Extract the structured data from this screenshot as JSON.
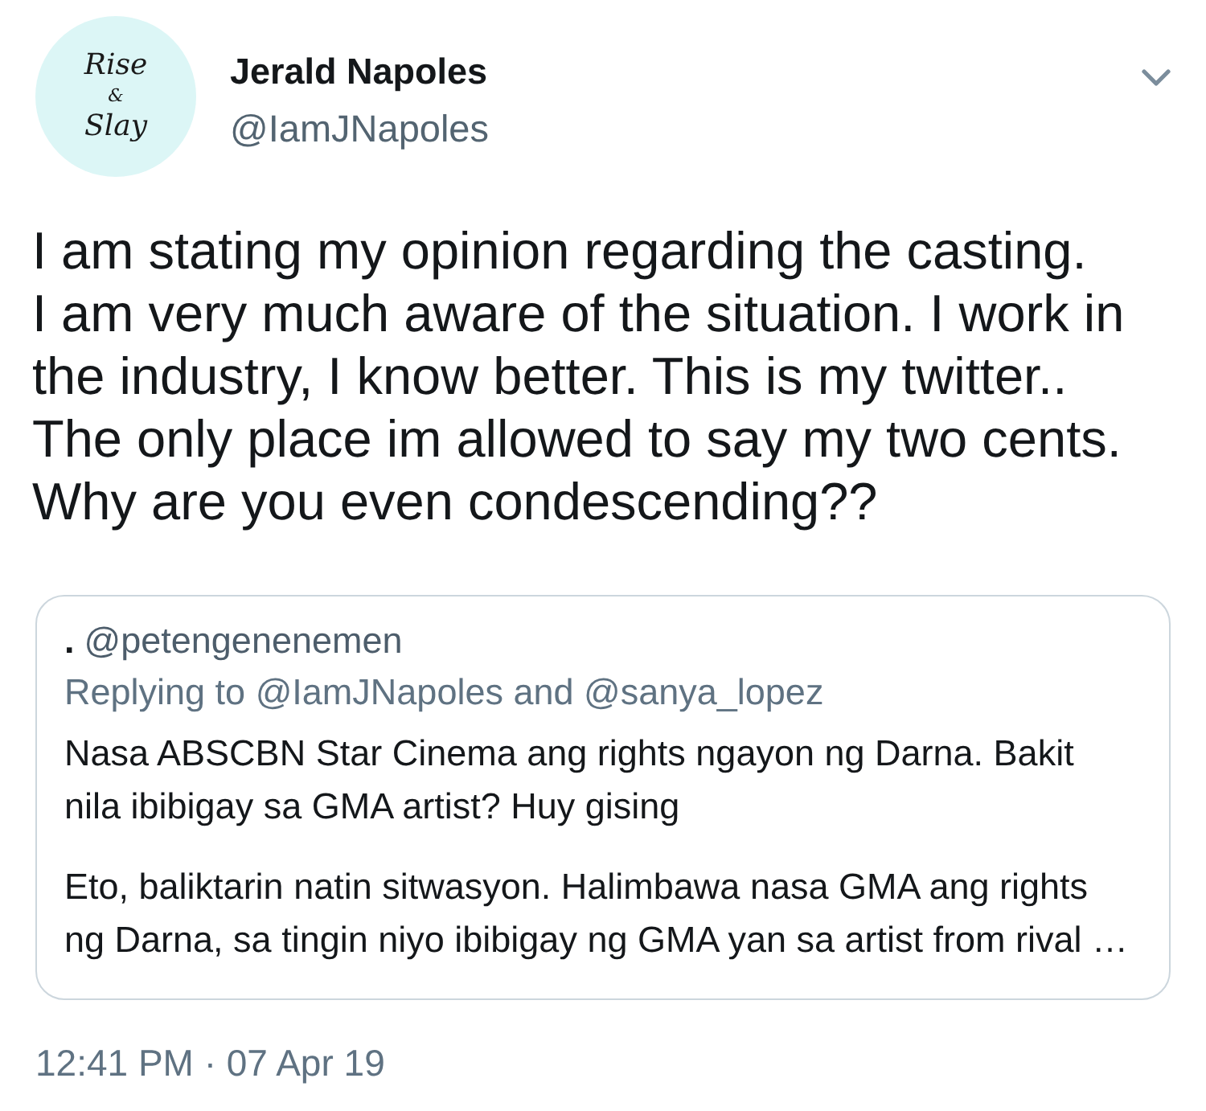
{
  "avatar": {
    "lines": [
      "Rise",
      "&",
      "Slay"
    ]
  },
  "author": {
    "name": "Jerald Napoles",
    "handle": "@IamJNapoles"
  },
  "text": "I am stating my opinion regarding the casting.\nI am very much aware of the situation. I work in the industry, I know better. This is my twitter.. The only place im allowed to say my two cents. Why are you even condescending??",
  "quoted": {
    "name": ".",
    "handle": "@petengenenemen",
    "replying": "Replying to @IamJNapoles and @sanya_lopez",
    "paragraphs": [
      "Nasa ABSCBN Star Cinema ang rights ngayon ng Darna. Bakit nila ibibigay sa GMA artist? Huy gising",
      "Eto, baliktarin natin sitwasyon. Halimbawa nasa GMA ang rights ng Darna, sa tingin niyo ibibigay ng GMA yan sa artist from rival …"
    ]
  },
  "timestamp": "12:41 PM · 07 Apr 19"
}
